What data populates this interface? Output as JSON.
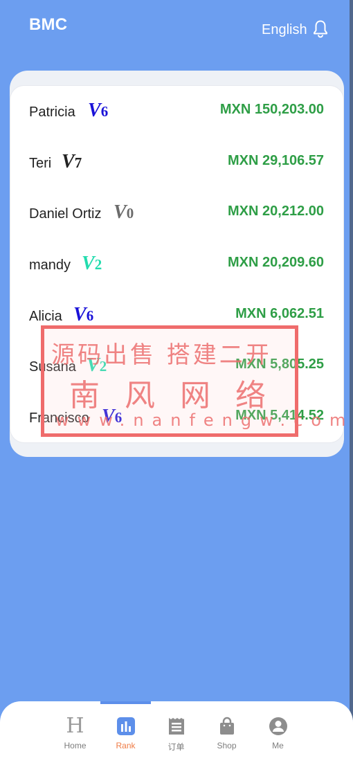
{
  "header": {
    "title": "BMC",
    "language": "English",
    "bell_icon": "bell-icon"
  },
  "ranking": [
    {
      "name": "Patricia",
      "vip_level": "6",
      "vip_color": "#1a12d8",
      "amount": "MXN 150,203.00"
    },
    {
      "name": "Teri",
      "vip_level": "7",
      "vip_color": "#222222",
      "amount": "MXN 29,106.57"
    },
    {
      "name": "Daniel Ortiz",
      "vip_level": "0",
      "vip_color": "#6b6b6b",
      "amount": "MXN 20,212.00"
    },
    {
      "name": "mandy",
      "vip_level": "2",
      "vip_color": "#22dcae",
      "amount": "MXN 20,209.60"
    },
    {
      "name": "Alicia",
      "vip_level": "6",
      "vip_color": "#1a12d8",
      "amount": "MXN 6,062.51"
    },
    {
      "name": "Susana",
      "vip_level": "2",
      "vip_color": "#22dcae",
      "amount": "MXN 5,805.25"
    },
    {
      "name": "Francisco",
      "vip_level": "6",
      "vip_color": "#1a12d8",
      "amount": "MXN 5,414.52"
    }
  ],
  "watermark": {
    "line1": "源码出售 搭建二开",
    "line2": "南风网络",
    "line3": "www.nanfengw.com"
  },
  "tabs": [
    {
      "label": "Home",
      "icon": "home-icon",
      "active": false
    },
    {
      "label": "Rank",
      "icon": "rank-icon",
      "active": true
    },
    {
      "label": "订单",
      "icon": "order-icon",
      "active": false
    },
    {
      "label": "Shop",
      "icon": "shop-icon",
      "active": false
    },
    {
      "label": "Me",
      "icon": "user-icon",
      "active": false
    }
  ],
  "colors": {
    "primary_bg": "#6c9ef0",
    "amount_green": "#2e9e46",
    "active_tab": "#ef7b45",
    "watermark_red": "#ef6c6c"
  }
}
